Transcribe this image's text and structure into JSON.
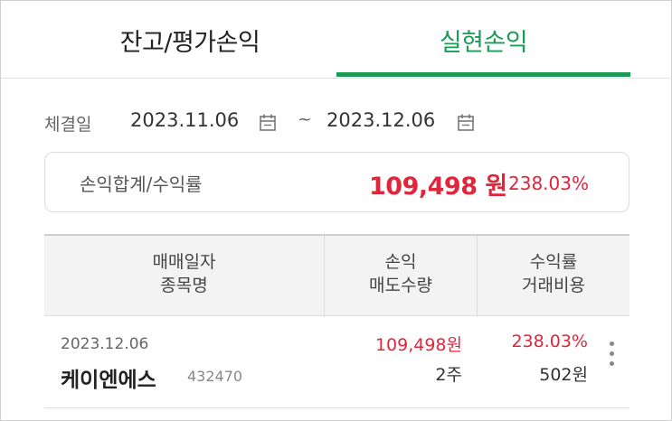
{
  "tabs": [
    {
      "label": "잔고/평가손익",
      "active": false
    },
    {
      "label": "실현손익",
      "active": true
    }
  ],
  "colors": {
    "accent": "#1a9c56",
    "positive": "#e0263a"
  },
  "date_filter": {
    "label": "체결일",
    "start": "2023.11.06",
    "separator": "~",
    "end": "2023.12.06",
    "icon": "calendar-icon"
  },
  "summary": {
    "label": "손익합계/수익률",
    "amount": "109,498 원",
    "rate": "238.03%"
  },
  "table": {
    "headers": [
      {
        "line1": "매매일자",
        "line2": "종목명"
      },
      {
        "line1": "손익",
        "line2": "매도수량"
      },
      {
        "line1": "수익률",
        "line2": "거래비용"
      }
    ],
    "rows": [
      {
        "date": "2023.12.06",
        "name": "케이엔에스",
        "code": "432470",
        "pl": "109,498원",
        "qty": "2주",
        "rate": "238.03%",
        "fee": "502원",
        "menu_icon": "more-vertical-icon"
      }
    ]
  }
}
